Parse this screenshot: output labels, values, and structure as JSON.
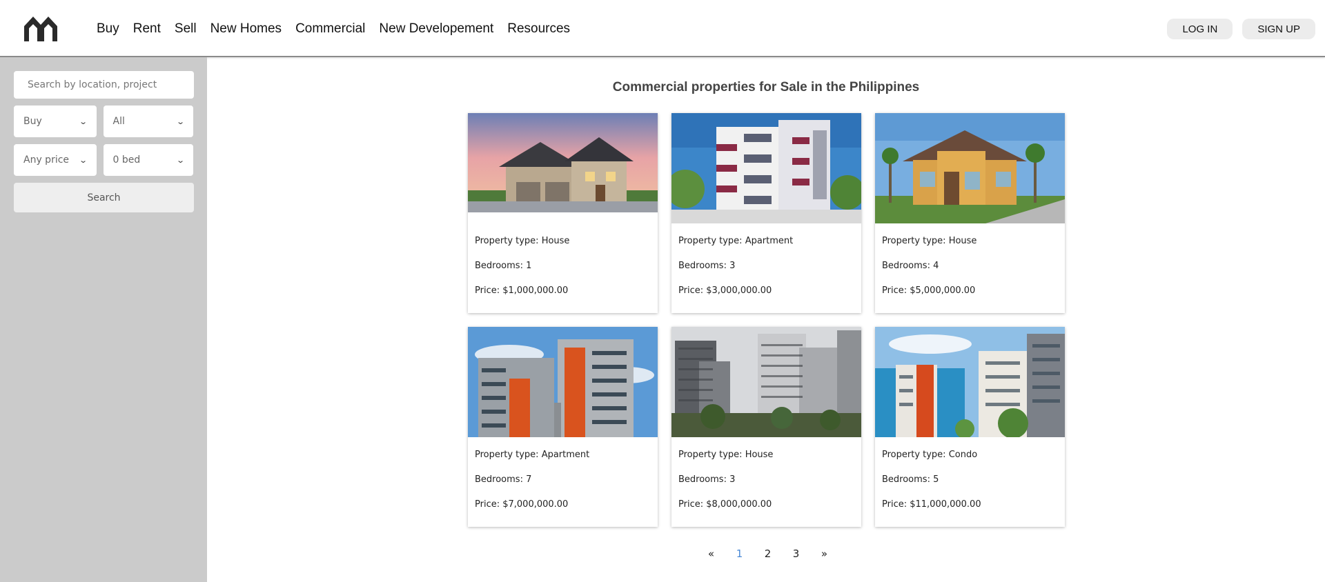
{
  "nav": {
    "items": [
      "Buy",
      "Rent",
      "Sell",
      "New Homes",
      "Commercial",
      "New Developement",
      "Resources"
    ]
  },
  "auth": {
    "login": "LOG IN",
    "signup": "SIGN UP"
  },
  "sidebar": {
    "search_placeholder": "Search by location, project",
    "transaction": "Buy",
    "type": "All",
    "price": "Any price",
    "beds": "0 bed",
    "search_label": "Search"
  },
  "main": {
    "title": "Commercial properties for Sale in the Philippines",
    "listings": [
      {
        "type_line": "Property type: House",
        "beds_line": "Bedrooms: 1",
        "price_line": "Price: $1,000,000.00"
      },
      {
        "type_line": "Property type: Apartment",
        "beds_line": "Bedrooms: 3",
        "price_line": "Price: $3,000,000.00"
      },
      {
        "type_line": "Property type: House",
        "beds_line": "Bedrooms: 4",
        "price_line": "Price: $5,000,000.00"
      },
      {
        "type_line": "Property type: Apartment",
        "beds_line": "Bedrooms: 7",
        "price_line": "Price: $7,000,000.00"
      },
      {
        "type_line": "Property type: House",
        "beds_line": "Bedrooms: 3",
        "price_line": "Price: $8,000,000.00"
      },
      {
        "type_line": "Property type: Condo",
        "beds_line": "Bedrooms: 5",
        "price_line": "Price: $11,000,000.00"
      }
    ]
  },
  "pagination": {
    "prev": "«",
    "pages": [
      "1",
      "2",
      "3"
    ],
    "next": "»",
    "current": "1"
  },
  "colors": {
    "sidebar_bg": "#cbcbcb",
    "active_page": "#4a8ad6"
  }
}
